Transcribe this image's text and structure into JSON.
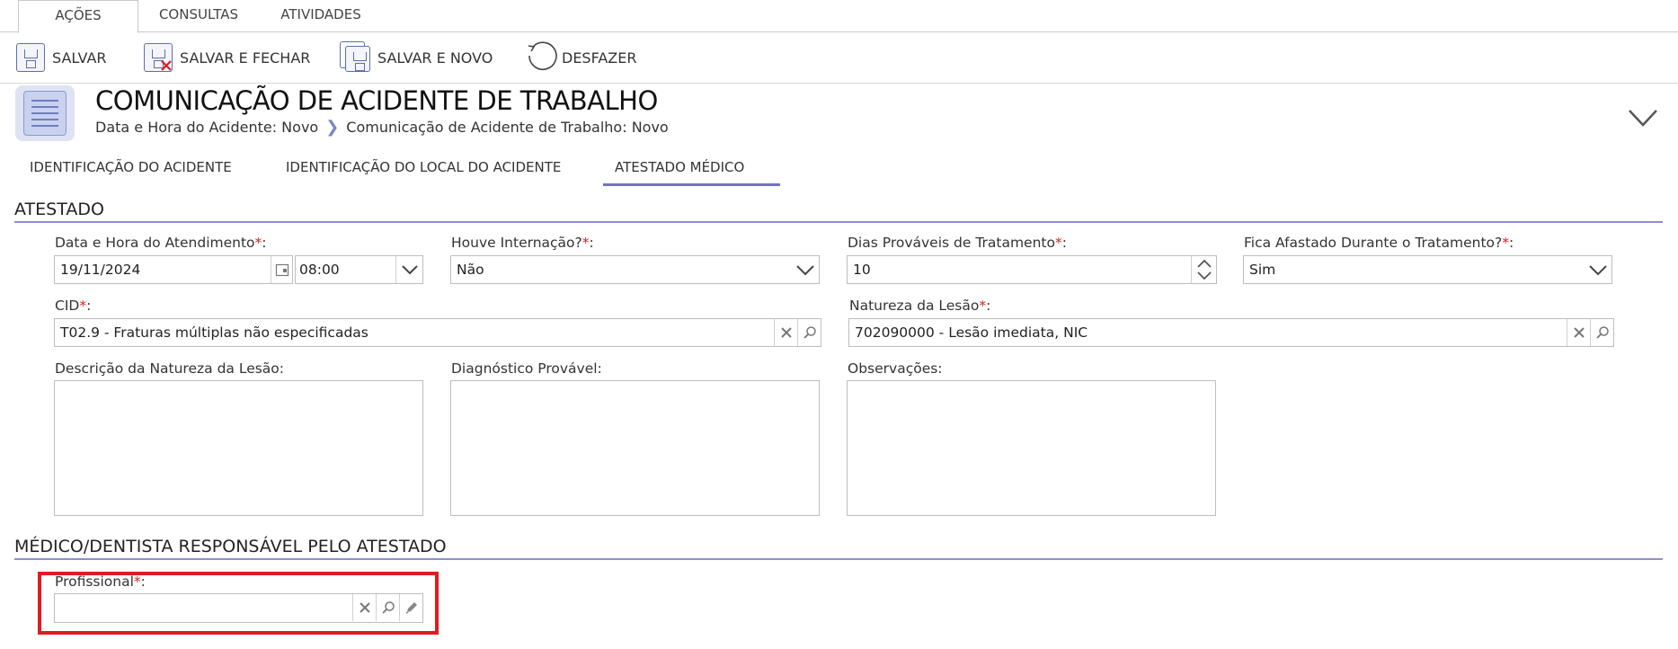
{
  "ribbon": {
    "tabs": [
      "AÇÕES",
      "CONSULTAS",
      "ATIVIDADES"
    ]
  },
  "toolbar": {
    "save": "SALVAR",
    "save_close": "SALVAR E FECHAR",
    "save_new": "SALVAR E NOVO",
    "undo": "DESFAZER"
  },
  "header": {
    "title": "COMUNICAÇÃO DE ACIDENTE DE TRABALHO",
    "breadcrumb": [
      "Data e Hora do Acidente: Novo",
      "Comunicação de Acidente de Trabalho: Novo"
    ]
  },
  "section_tabs": [
    "IDENTIFICAÇÃO DO ACIDENTE",
    "IDENTIFICAÇÃO DO LOCAL DO ACIDENTE",
    "ATESTADO MÉDICO"
  ],
  "atestado": {
    "title": "ATESTADO",
    "data_hora": {
      "label": "Data e Hora do Atendimento",
      "date": "19/11/2024",
      "time": "08:00"
    },
    "internacao": {
      "label": "Houve Internação?",
      "value": "Não"
    },
    "dias": {
      "label": "Dias Prováveis de Tratamento",
      "value": "10"
    },
    "afastado": {
      "label": "Fica Afastado Durante o Tratamento?",
      "value": "Sim"
    },
    "cid": {
      "label": "CID",
      "value": "T02.9 - Fraturas múltiplas não especificadas"
    },
    "natureza": {
      "label": "Natureza da Lesão",
      "value": "702090000 - Lesão imediata, NIC"
    },
    "descricao": {
      "label": "Descrição da Natureza da Lesão:"
    },
    "diagnostico": {
      "label": "Diagnóstico Provável:"
    },
    "observacoes": {
      "label": "Observações:"
    }
  },
  "medico": {
    "title": "MÉDICO/DENTISTA RESPONSÁVEL PELO ATESTADO",
    "profissional": {
      "label": "Profissional",
      "value": ""
    }
  },
  "colors": {
    "accent": "#7173c7",
    "required": "#e01b1b",
    "highlight": "#e11b22"
  }
}
